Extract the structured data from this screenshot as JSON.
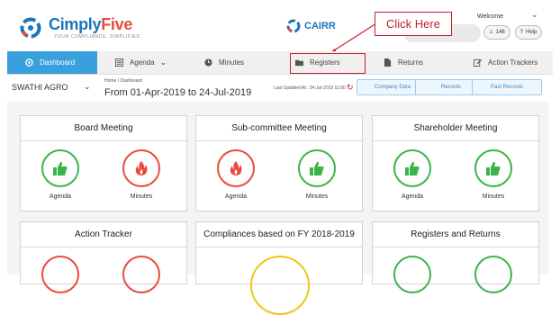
{
  "brand": {
    "name_part1": "Cimply",
    "name_part2": "Five",
    "tagline": "YOUR COMPLIANCE. SIMPLIFIED.",
    "cairr": "CAIRR"
  },
  "annotation": {
    "callout": "Click Here"
  },
  "header": {
    "welcome": "Welcome",
    "chev": "⌄",
    "notif": "146",
    "help": "Help"
  },
  "nav": [
    {
      "label": "Dashboard",
      "icon": "dashboard-icon"
    },
    {
      "label": "Agenda",
      "icon": "list-icon"
    },
    {
      "label": "Minutes",
      "icon": "clock-icon"
    },
    {
      "label": "Registers",
      "icon": "folder-icon"
    },
    {
      "label": "Returns",
      "icon": "document-icon"
    },
    {
      "label": "Action Trackers",
      "icon": "edit-icon"
    }
  ],
  "filter": {
    "company": "SWATHI AGRO",
    "breadcrumb": "Home  /  Dashboard",
    "period": "From 01-Apr-2019 to 24-Jul-2019",
    "updated": "Last Updated At : 24-Jul-2019 11:00",
    "buttons": [
      "Company Data",
      "Records",
      "Past Records"
    ]
  },
  "cards": [
    {
      "title": "Board Meeting",
      "items": [
        {
          "label": "Agenda",
          "status": "thumb"
        },
        {
          "label": "Minutes",
          "status": "fire"
        }
      ]
    },
    {
      "title": "Sub-committee Meeting",
      "items": [
        {
          "label": "Agenda",
          "status": "fire"
        },
        {
          "label": "Minutes",
          "status": "thumb"
        }
      ]
    },
    {
      "title": "Shareholder Meeting",
      "items": [
        {
          "label": "Agenda",
          "status": "thumb"
        },
        {
          "label": "Minutes",
          "status": "thumb"
        }
      ]
    },
    {
      "title": "Action Tracker"
    },
    {
      "title": "Compliances based on FY 2018-2019"
    },
    {
      "title": "Registers and Returns"
    }
  ],
  "colors": {
    "accent": "#3aa0dd",
    "green": "#3bb54a",
    "red": "#e84c3d",
    "yellow": "#f0c419",
    "annotation": "#c0202a"
  }
}
